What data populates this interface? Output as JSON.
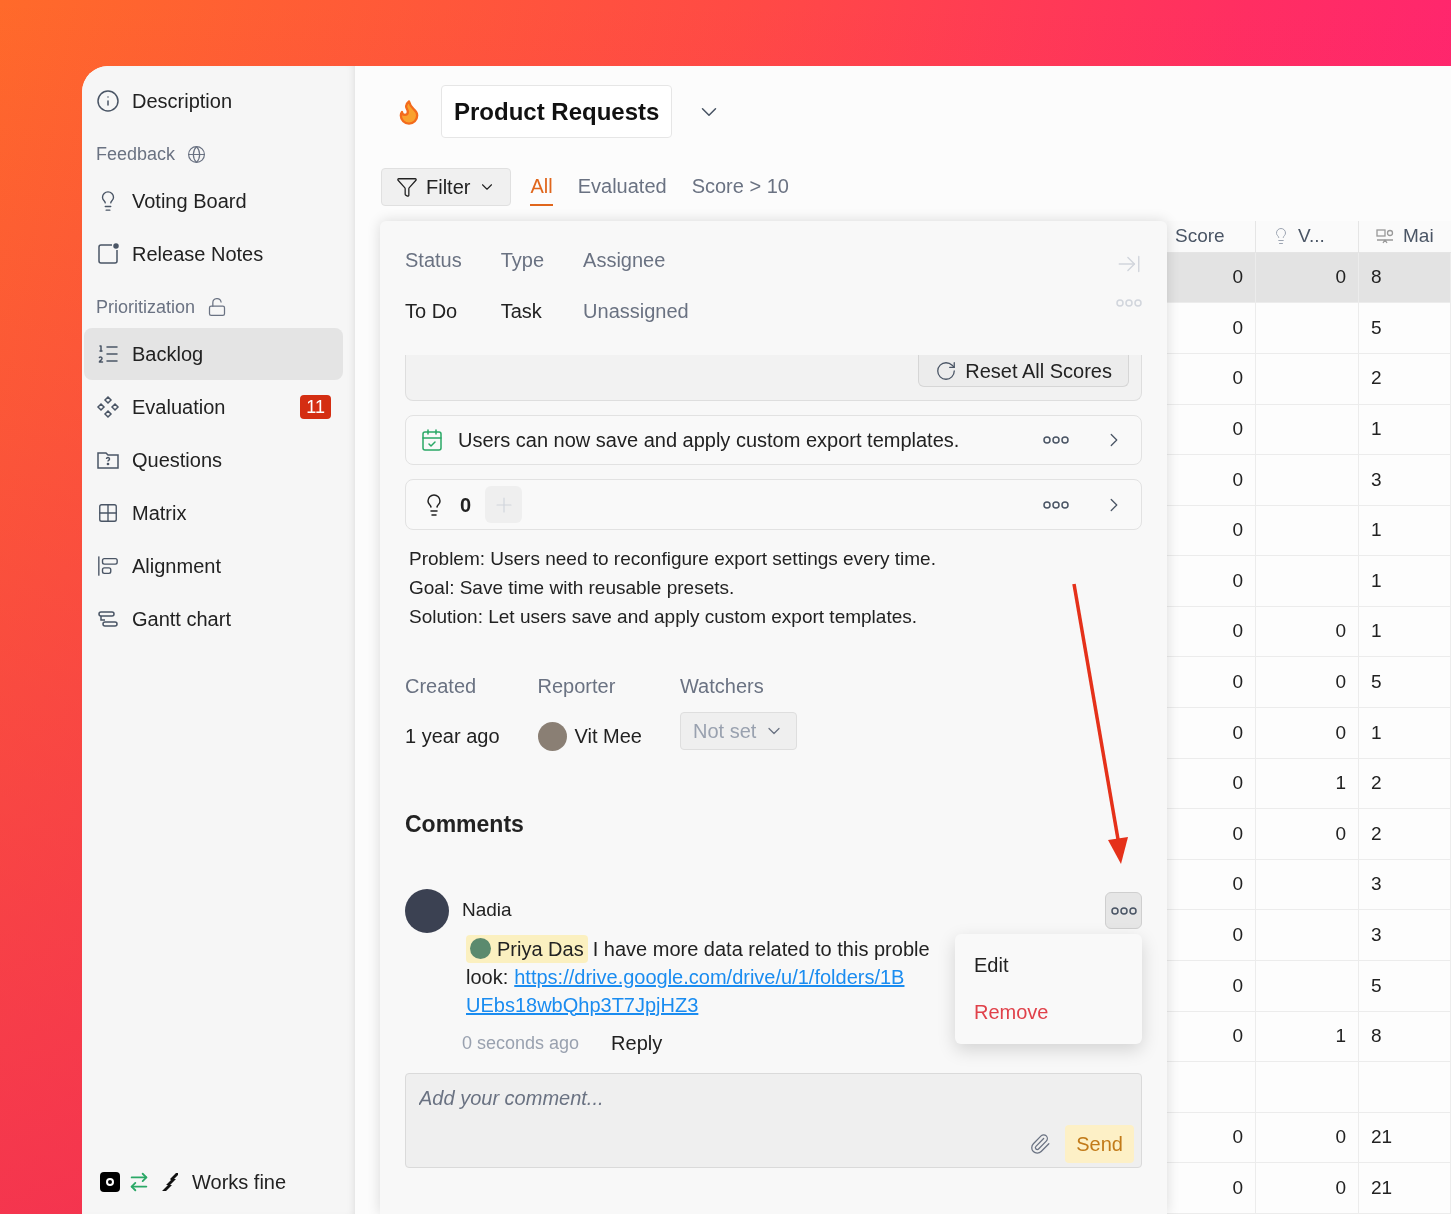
{
  "sidebar": {
    "top_item": {
      "label": "Description",
      "selected": false
    },
    "sections": [
      {
        "title": "Feedback",
        "items": [
          {
            "label": "Voting Board",
            "selected": false
          },
          {
            "label": "Release Notes",
            "selected": false
          }
        ]
      },
      {
        "title": "Prioritization",
        "items": [
          {
            "label": "Backlog",
            "selected": true
          },
          {
            "label": "Evaluation",
            "selected": false,
            "badge": "11"
          },
          {
            "label": "Questions",
            "selected": false
          },
          {
            "label": "Matrix",
            "selected": false
          },
          {
            "label": "Alignment",
            "selected": false
          },
          {
            "label": "Gantt chart",
            "selected": false
          }
        ]
      }
    ],
    "footer": {
      "status": "Works fine"
    }
  },
  "header": {
    "title": "Product Requests"
  },
  "filter": {
    "label": "Filter"
  },
  "tabs": [
    {
      "label": "All",
      "selected": true
    },
    {
      "label": "Evaluated",
      "selected": false
    },
    {
      "label": "Score > 10",
      "selected": false
    }
  ],
  "detail": {
    "fields": [
      {
        "label": "Status",
        "value": "To Do",
        "kind": "plain"
      },
      {
        "label": "Type",
        "value": "Task",
        "kind": "plain"
      },
      {
        "label": "Assignee",
        "value": "Unassigned",
        "kind": "muted"
      }
    ],
    "reset_button": "Reset All Scores",
    "release_note": "Users can now save and apply custom export templates.",
    "votes": {
      "count": "0"
    },
    "description": [
      "Problem: Users need to reconfigure export settings every time.",
      "Goal: Save time with reusable presets.",
      "Solution: Let users save and apply custom export templates."
    ],
    "meta": {
      "created_label": "Created",
      "created": "1 year ago",
      "reporter_label": "Reporter",
      "reporter": "Vit Mee",
      "watchers_label": "Watchers",
      "watchers": "Not set"
    },
    "comments": {
      "title": "Comments",
      "items": [
        {
          "author": "Nadia",
          "mention": "Priya Das",
          "text": "I have more data related to this proble",
          "link_prefix": "look:",
          "link_line_1": "https://drive.google.com/drive/u/1/folders/1B",
          "link_line_2": "UEbs18wbQhp3T7JpjHZ3",
          "time": "0 seconds ago",
          "reply": "Reply"
        }
      ]
    },
    "menu": [
      {
        "label": "Edit",
        "kind": "normal"
      },
      {
        "label": "Remove",
        "kind": "danger"
      }
    ],
    "composer": {
      "placeholder": "Add your comment...",
      "send": "Send"
    }
  },
  "table": {
    "columns": [
      {
        "label": "Score"
      },
      {
        "label": "V..."
      },
      {
        "label": "Mai"
      }
    ],
    "rows": [
      {
        "selected": true,
        "score": "0",
        "votes": "0",
        "column_3": "8"
      },
      {
        "selected": false,
        "score": "0",
        "column_3": "5"
      },
      {
        "selected": false,
        "score": "0",
        "column_3": "2"
      },
      {
        "selected": false,
        "score": "0",
        "column_3": "1"
      },
      {
        "selected": false,
        "score": "0",
        "column_3": "3"
      },
      {
        "selected": false,
        "score": "0",
        "column_3": "1"
      },
      {
        "selected": false,
        "score": "0",
        "column_3": "1"
      },
      {
        "selected": false,
        "score": "0",
        "votes": "0",
        "column_3": "1"
      },
      {
        "selected": false,
        "score": "0",
        "votes": "0",
        "column_3": "5"
      },
      {
        "selected": false,
        "score": "0",
        "votes": "0",
        "column_3": "1"
      },
      {
        "selected": false,
        "score": "0",
        "votes": "1",
        "column_3": "2"
      },
      {
        "selected": false,
        "score": "0",
        "votes": "0",
        "column_3": "2"
      },
      {
        "selected": false,
        "score": "0",
        "column_3": "3"
      },
      {
        "selected": false,
        "score": "0",
        "column_3": "3"
      },
      {
        "selected": false,
        "score": "0",
        "column_3": "5"
      },
      {
        "selected": false,
        "score": "0",
        "votes": "1",
        "column_3": "8"
      },
      {
        "selected": false
      },
      {
        "selected": false,
        "score": "0",
        "votes": "0",
        "column_3": "21"
      },
      {
        "selected": false,
        "score": "0",
        "votes": "0",
        "column_3": "21"
      }
    ]
  }
}
